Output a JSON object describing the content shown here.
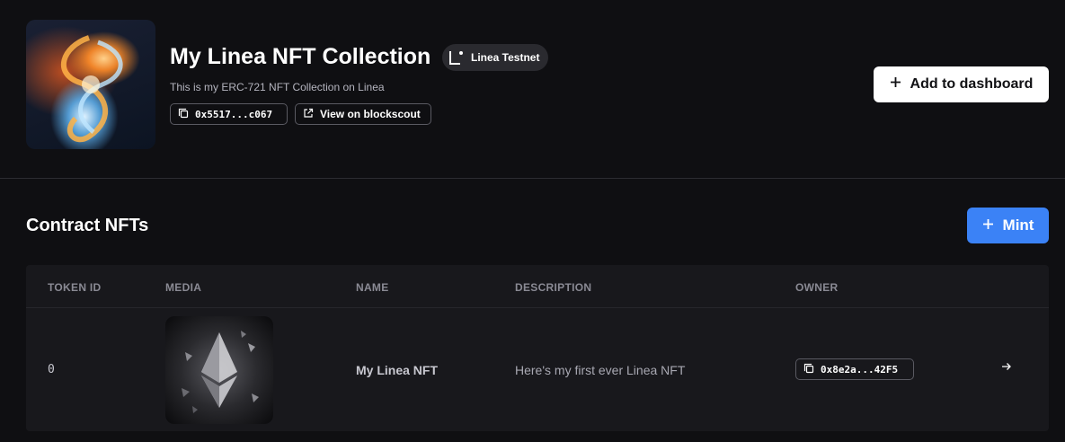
{
  "contract": {
    "title": "My Linea NFT Collection",
    "network_badge": "Linea Testnet",
    "description": "This is my ERC-721 NFT Collection on Linea",
    "address_short": "0x5517...c067",
    "explorer_link": "View on blockscout",
    "add_button": "Add to dashboard"
  },
  "nfts_section": {
    "title": "Contract NFTs",
    "mint_button": "Mint",
    "columns": [
      "TOKEN ID",
      "MEDIA",
      "NAME",
      "DESCRIPTION",
      "OWNER"
    ],
    "rows": [
      {
        "token_id": "0",
        "name": "My Linea NFT",
        "description": "Here's my first ever Linea NFT",
        "owner_short": "0x8e2a...42F5"
      }
    ]
  },
  "icons": {
    "copy": "copy-icon",
    "external": "external-link-icon",
    "plus": "plus-icon",
    "arrow": "arrow-right-icon",
    "network": "linea-logo-icon"
  },
  "colors": {
    "background": "#0f0f12",
    "table_bg": "#18181c",
    "primary": "#3b82f6",
    "white_button": "#ffffff"
  }
}
